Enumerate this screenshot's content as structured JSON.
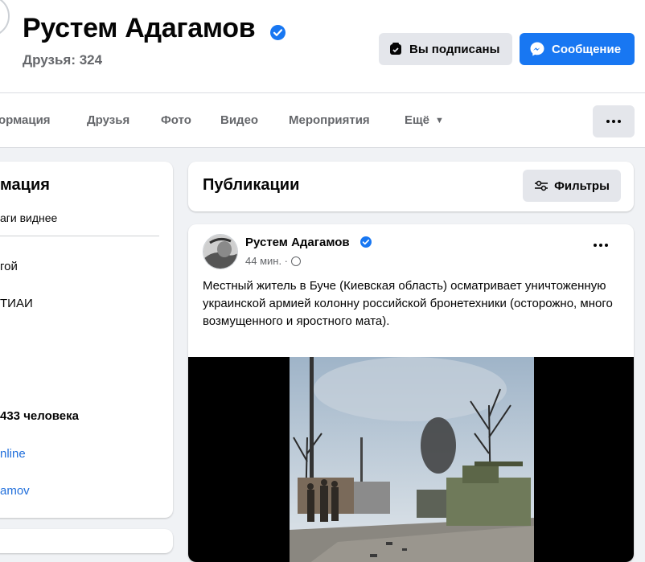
{
  "profile": {
    "name": "Рустем Адагамов",
    "friends": "Друзья: 324",
    "subscribed_label": "Вы подписаны",
    "message_label": "Сообщение"
  },
  "tabs": [
    "ормация",
    "Друзья",
    "Фото",
    "Видео",
    "Мероприятия",
    "Ещё"
  ],
  "intro": {
    "title": "мация",
    "tagline": "аги виднее",
    "lines": [
      "гой",
      "ТИАИ",
      "433 человека",
      "nline",
      "amov"
    ]
  },
  "publications": {
    "title": "Публикации",
    "filters_label": "Фильтры"
  },
  "post": {
    "author": "Рустем Адагамов",
    "time": "44 мин. ·",
    "text": "Местный житель в Буче (Киевская область) осматривает уничтоженную украинской армией колонну российской бронетехники (осторожно, много возмущенного и яростного мата)."
  },
  "colors": {
    "accent": "#1877f2",
    "link": "#216fdb",
    "background": "#f0f2f5"
  }
}
